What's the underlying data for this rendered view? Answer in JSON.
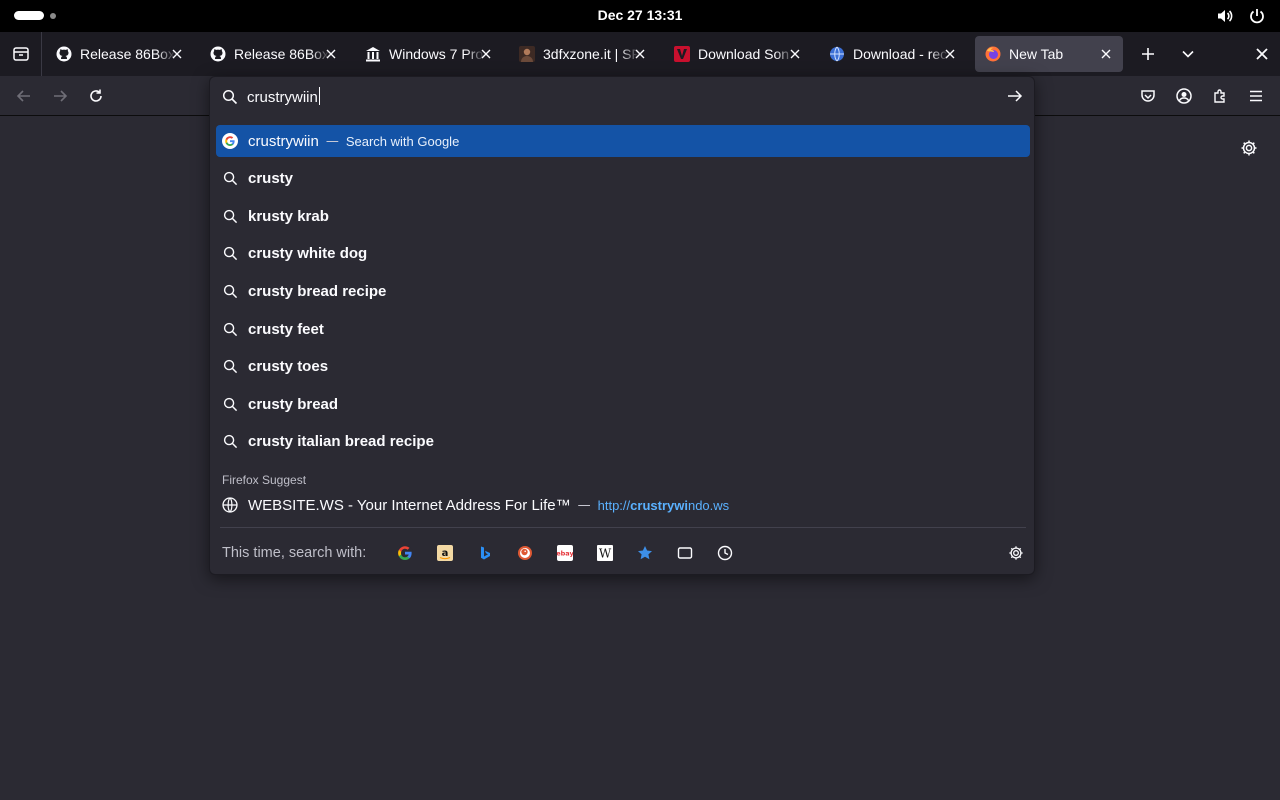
{
  "system_bar": {
    "datetime": "Dec 27  13:31",
    "icons": [
      "volume-icon",
      "power-icon"
    ]
  },
  "tabs": [
    {
      "title": "Release 86Box",
      "favicon": "github-icon",
      "active": false
    },
    {
      "title": "Release 86Box",
      "favicon": "github-icon",
      "active": false
    },
    {
      "title": "Windows 7 Pro",
      "favicon": "archive-icon",
      "active": false
    },
    {
      "title": "3dfxzone.it | SF",
      "favicon": "avatar-icon",
      "active": false
    },
    {
      "title": "Download Son",
      "favicon": "v-logo-icon",
      "active": false
    },
    {
      "title": "Download - rec",
      "favicon": "globe-blue-icon",
      "active": false
    },
    {
      "title": "New Tab",
      "favicon": "firefox-icon",
      "active": true
    }
  ],
  "urlbar": {
    "value": "crustrywiin"
  },
  "results": {
    "top": {
      "query": "crustrywiin",
      "separator": "—",
      "action": "Search with Google"
    },
    "suggestions": [
      "crusty",
      "krusty krab",
      "crusty white dog",
      "crusty bread recipe",
      "crusty feet",
      "crusty toes",
      "crusty bread",
      "crusty italian bread recipe"
    ],
    "firefox_suggest_label": "Firefox Suggest",
    "suggest_item": {
      "title": "WEBSITE.WS - Your Internet Address For Life™",
      "separator": "—",
      "url_prefix": "http://",
      "url_match": "crustrywi",
      "url_suffix": "ndo.ws"
    }
  },
  "footer": {
    "label": "This time, search with:",
    "engines": [
      "google-icon",
      "amazon-icon",
      "bing-icon",
      "duckduckgo-icon",
      "ebay-icon",
      "wikipedia-icon",
      "bookmarks-icon",
      "tabs-icon",
      "history-icon"
    ]
  },
  "colors": {
    "selected_row": "#1453a6",
    "url_link": "#5ab1ff",
    "background": "#2b2a33"
  }
}
